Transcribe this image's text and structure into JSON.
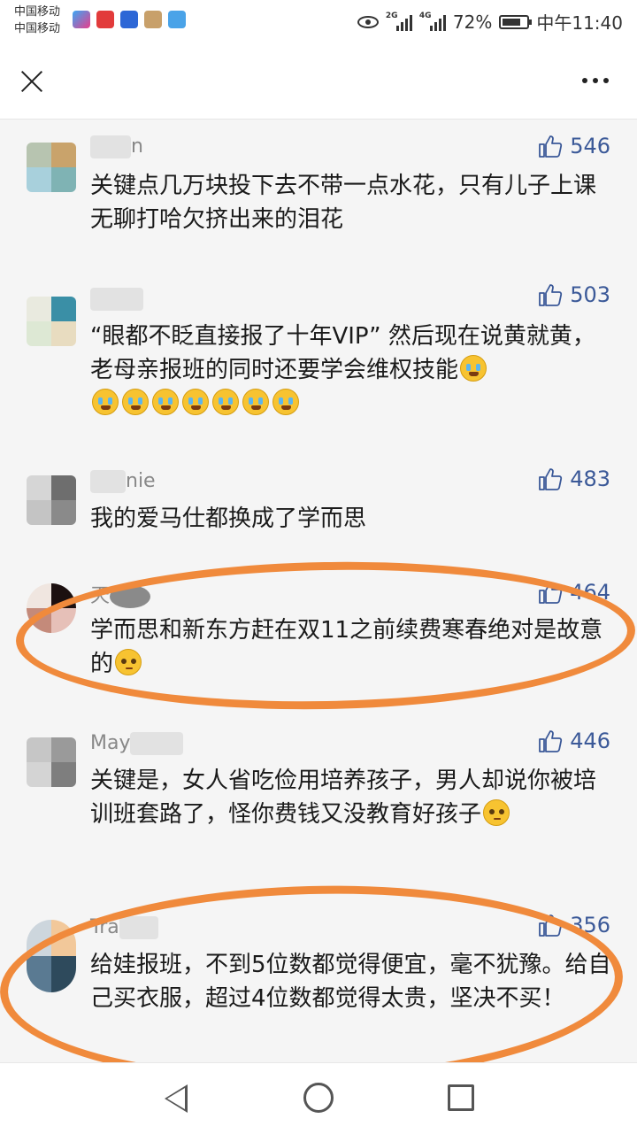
{
  "status_bar": {
    "carrier_1": "中国移动",
    "carrier_2": "中国移动",
    "network_1": "2G",
    "network_2": "4G",
    "battery": "72%",
    "time": "中午11:40",
    "icons": [
      "video-app-icon",
      "netease-app-icon",
      "baidu-app-icon",
      "huawei-app-icon",
      "message-app-icon",
      "eye-comfort-icon",
      "signal-icon",
      "battery-icon"
    ]
  },
  "header": {
    "close_icon": "close-icon",
    "more_icon": "more-icon"
  },
  "comments": [
    {
      "username": "n",
      "likes": "546",
      "text": "关键点几万块投下去不带一点水花，只有儿子上课无聊打哈欠挤出来的泪花",
      "emojis": 0
    },
    {
      "username": "",
      "likes": "503",
      "text": "“眼都不眨直接报了十年VIP” 然后现在说黄就黄，老母亲报班的同时还要学会维权技能",
      "emojis": 7
    },
    {
      "username": "nie",
      "likes": "483",
      "text": "我的爱马仕都换成了学而思",
      "emojis": 0
    },
    {
      "username": "天",
      "likes": "464",
      "text": "学而思和新东方赶在双11之前续费寒春绝对是故意的",
      "emojis": 1
    },
    {
      "username": "May",
      "likes": "446",
      "text": "关键是，女人省吃俭用培养孩子，男人却说你被培训班套路了，怪你费钱又没教育好孩子",
      "emojis": 1
    },
    {
      "username": "Tra",
      "likes": "356",
      "text": "给娃报班，不到5位数都觉得便宜，毫不犹豫。给自己买衣服，超过4位数都觉得太贵，坚决不买！",
      "emojis": 0
    }
  ],
  "colors": {
    "highlight": "#f08a3c",
    "like": "#3b5998"
  },
  "nav": {
    "icons": [
      "back-icon",
      "home-icon",
      "recents-icon"
    ]
  }
}
